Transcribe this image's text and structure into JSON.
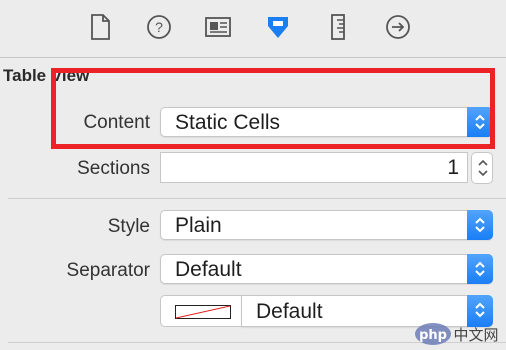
{
  "inspector_tabs": [
    {
      "icon": "file-icon"
    },
    {
      "icon": "help-icon"
    },
    {
      "icon": "identity-icon"
    },
    {
      "icon": "attributes-icon",
      "selected": true
    },
    {
      "icon": "size-ruler-icon"
    },
    {
      "icon": "connections-arrow-icon"
    }
  ],
  "section": {
    "title": "Table View"
  },
  "content": {
    "label": "Content",
    "value": "Static Cells"
  },
  "sections": {
    "label": "Sections",
    "value": "1"
  },
  "style": {
    "label": "Style",
    "value": "Plain"
  },
  "separator": {
    "label": "Separator",
    "value": "Default",
    "color_value": "Default"
  },
  "colors": {
    "accent": "#1a7ef5",
    "highlight": "#ec2226",
    "background": "#ececec"
  },
  "watermark": {
    "text": "php 中文网"
  }
}
